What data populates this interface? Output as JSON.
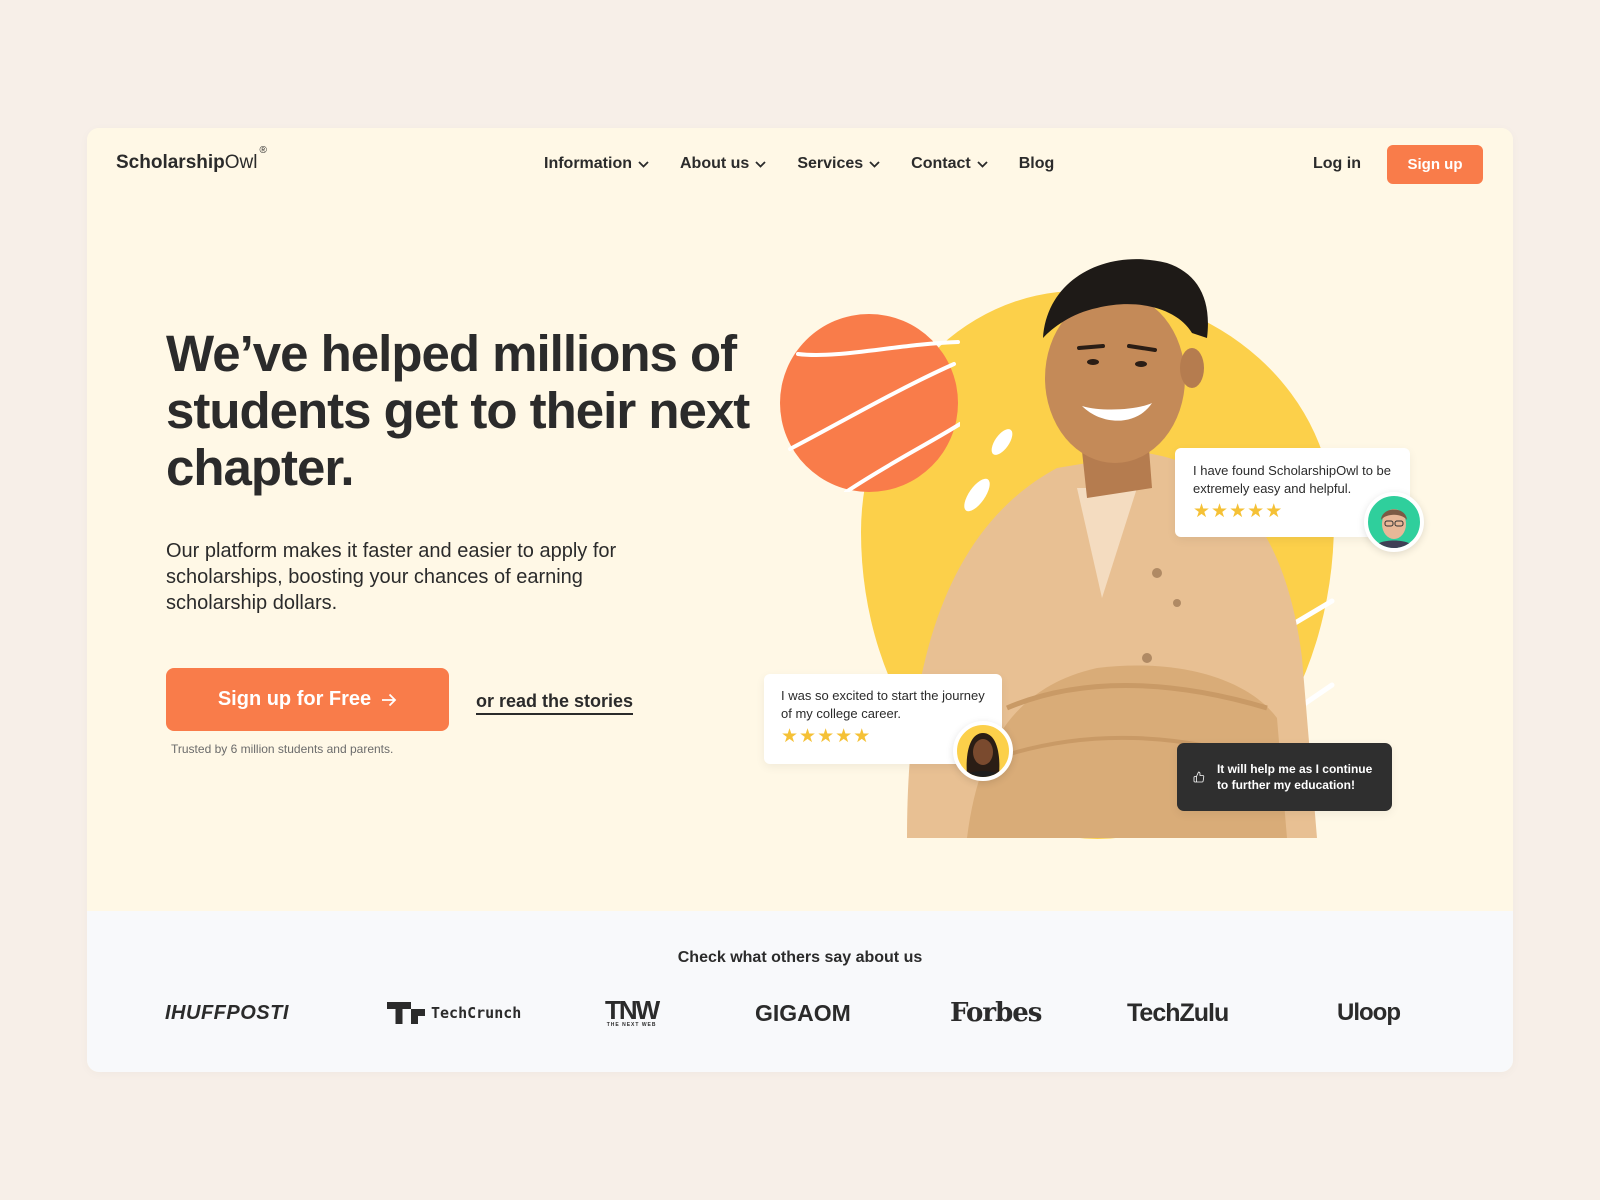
{
  "brand": {
    "bold": "Scholarship",
    "light": "Owl",
    "mark": "®"
  },
  "nav": {
    "items": [
      "Information",
      "About us",
      "Services",
      "Contact",
      "Blog"
    ],
    "login": "Log in",
    "signup": "Sign up"
  },
  "hero": {
    "headline": "We’ve helped millions of students get to their next chapter.",
    "subtext": "Our platform makes it faster and easier to apply for scholarships, boosting your chances of earning scholarship dollars.",
    "cta": "Sign up for Free",
    "secondary_link": "or read the stories",
    "trusted": "Trusted by 6 million students and parents."
  },
  "testimonials": [
    {
      "text": "I have found ScholarshipOwl to be extremely easy and helpful.",
      "rating": 5
    },
    {
      "text": "I was so excited to start the journey of my college career.",
      "rating": 5
    },
    {
      "text": "It will help me as I continue to further my education!",
      "icon": "thumbs-up-icon"
    }
  ],
  "press": {
    "title": "Check what others say about us",
    "logos": [
      "IHUFFPOSTI",
      "TechCrunch",
      "TNW",
      "THE NEXT WEB",
      "GIGAOM",
      "Forbes",
      "TechZulu",
      "Uloop"
    ]
  },
  "colors": {
    "accent": "#f97c4a",
    "yellow": "#fcd04a",
    "hero_bg": "#fff8e6",
    "page_bg": "#f7efe8",
    "star": "#f5c136",
    "dark": "#2b2b2b"
  }
}
